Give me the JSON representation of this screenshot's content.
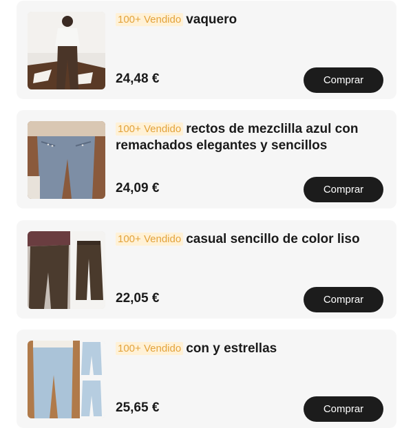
{
  "products": [
    {
      "badge": "100+ Vendido",
      "title": "vaquero",
      "price": "24,48 €",
      "button": "Comprar"
    },
    {
      "badge": "100+ Vendido",
      "title": "rectos de mezclilla azul con remachados elegantes y sencillos",
      "price": "24,09 €",
      "button": "Comprar"
    },
    {
      "badge": "100+ Vendido",
      "title": "casual sencillo de color liso",
      "price": "22,05 €",
      "button": "Comprar"
    },
    {
      "badge": "100+ Vendido",
      "title": "con y estrellas",
      "price": "25,65 €",
      "button": "Comprar"
    }
  ],
  "colors": {
    "badge_text": "#e3a33b",
    "badge_bg": "#fff1d6",
    "button_bg": "#1c1c1c",
    "card_bg": "#f6f6f6"
  }
}
